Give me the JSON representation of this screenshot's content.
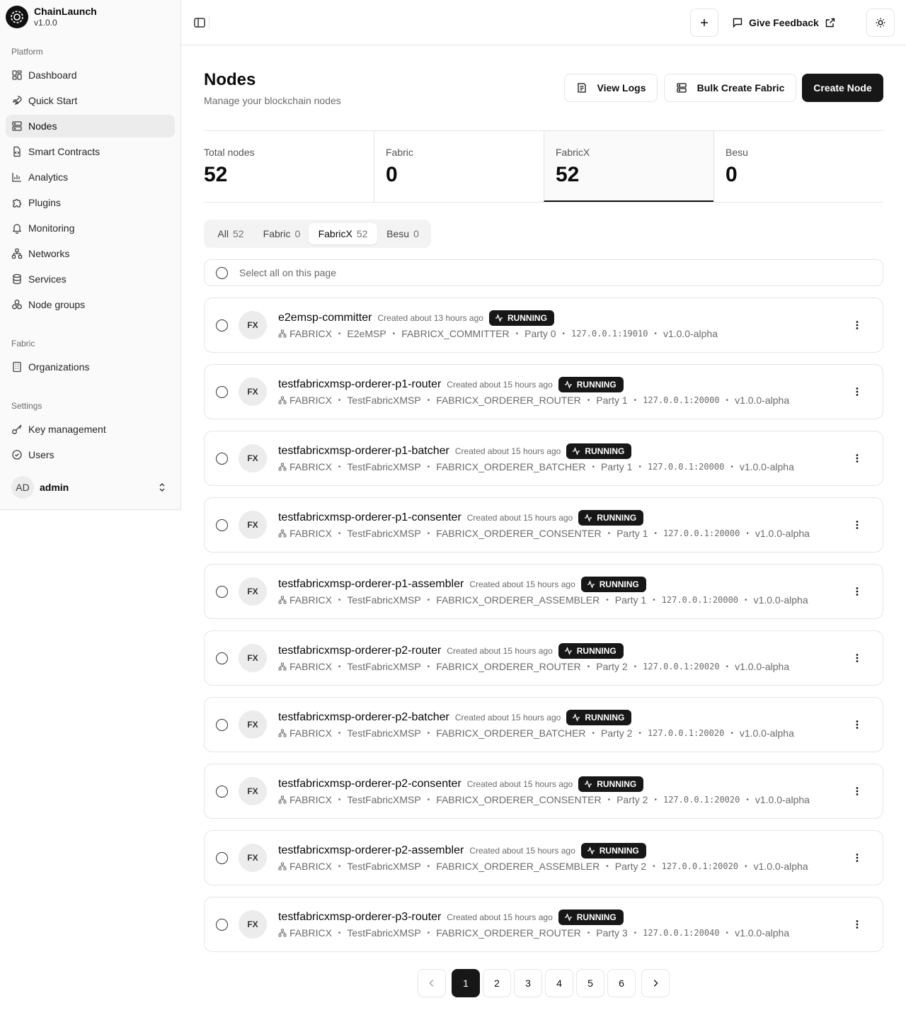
{
  "brand": {
    "name": "ChainLaunch",
    "version": "v1.0.0"
  },
  "sidebar": {
    "groups": [
      {
        "label": "Platform",
        "items": [
          {
            "label": "Dashboard",
            "icon": "dashboard-icon"
          },
          {
            "label": "Quick Start",
            "icon": "rocket-icon"
          },
          {
            "label": "Nodes",
            "icon": "server-icon",
            "active": true
          },
          {
            "label": "Smart Contracts",
            "icon": "file-code-icon"
          },
          {
            "label": "Analytics",
            "icon": "bar-chart-icon"
          },
          {
            "label": "Plugins",
            "icon": "puzzle-icon"
          },
          {
            "label": "Monitoring",
            "icon": "bell-icon"
          },
          {
            "label": "Networks",
            "icon": "network-icon"
          },
          {
            "label": "Services",
            "icon": "database-icon"
          },
          {
            "label": "Node groups",
            "icon": "boxes-icon"
          }
        ]
      },
      {
        "label": "Fabric",
        "items": [
          {
            "label": "Organizations",
            "icon": "building-icon"
          }
        ]
      },
      {
        "label": "Settings",
        "items": [
          {
            "label": "Key management",
            "icon": "key-icon"
          },
          {
            "label": "Users",
            "icon": "user-check-icon"
          }
        ]
      }
    ],
    "user": {
      "initials": "AD",
      "name": "admin"
    }
  },
  "header": {
    "feedback_label": "Give Feedback"
  },
  "page": {
    "title": "Nodes",
    "subtitle": "Manage your blockchain nodes",
    "view_logs_label": "View Logs",
    "bulk_create_label": "Bulk Create Fabric",
    "create_node_label": "Create Node"
  },
  "stats": [
    {
      "label": "Total nodes",
      "value": "52"
    },
    {
      "label": "Fabric",
      "value": "0"
    },
    {
      "label": "FabricX",
      "value": "52",
      "active": true
    },
    {
      "label": "Besu",
      "value": "0"
    }
  ],
  "tabs": [
    {
      "label": "All",
      "count": "52"
    },
    {
      "label": "Fabric",
      "count": "0"
    },
    {
      "label": "FabricX",
      "count": "52",
      "active": true
    },
    {
      "label": "Besu",
      "count": "0"
    }
  ],
  "select_all_label": "Select all on this page",
  "nodes": [
    {
      "avatar": "FX",
      "name": "e2emsp-committer",
      "created": "Created about 13 hours ago",
      "status": "RUNNING",
      "platform": "FABRICX",
      "msp": "E2eMSP",
      "role": "FABRICX_COMMITTER",
      "party": "Party 0",
      "address": "127.0.0.1:19010",
      "version": "v1.0.0-alpha"
    },
    {
      "avatar": "FX",
      "name": "testfabricxmsp-orderer-p1-router",
      "created": "Created about 15 hours ago",
      "status": "RUNNING",
      "platform": "FABRICX",
      "msp": "TestFabricXMSP",
      "role": "FABRICX_ORDERER_ROUTER",
      "party": "Party 1",
      "address": "127.0.0.1:20000",
      "version": "v1.0.0-alpha"
    },
    {
      "avatar": "FX",
      "name": "testfabricxmsp-orderer-p1-batcher",
      "created": "Created about 15 hours ago",
      "status": "RUNNING",
      "platform": "FABRICX",
      "msp": "TestFabricXMSP",
      "role": "FABRICX_ORDERER_BATCHER",
      "party": "Party 1",
      "address": "127.0.0.1:20000",
      "version": "v1.0.0-alpha"
    },
    {
      "avatar": "FX",
      "name": "testfabricxmsp-orderer-p1-consenter",
      "created": "Created about 15 hours ago",
      "status": "RUNNING",
      "platform": "FABRICX",
      "msp": "TestFabricXMSP",
      "role": "FABRICX_ORDERER_CONSENTER",
      "party": "Party 1",
      "address": "127.0.0.1:20000",
      "version": "v1.0.0-alpha"
    },
    {
      "avatar": "FX",
      "name": "testfabricxmsp-orderer-p1-assembler",
      "created": "Created about 15 hours ago",
      "status": "RUNNING",
      "platform": "FABRICX",
      "msp": "TestFabricXMSP",
      "role": "FABRICX_ORDERER_ASSEMBLER",
      "party": "Party 1",
      "address": "127.0.0.1:20000",
      "version": "v1.0.0-alpha"
    },
    {
      "avatar": "FX",
      "name": "testfabricxmsp-orderer-p2-router",
      "created": "Created about 15 hours ago",
      "status": "RUNNING",
      "platform": "FABRICX",
      "msp": "TestFabricXMSP",
      "role": "FABRICX_ORDERER_ROUTER",
      "party": "Party 2",
      "address": "127.0.0.1:20020",
      "version": "v1.0.0-alpha"
    },
    {
      "avatar": "FX",
      "name": "testfabricxmsp-orderer-p2-batcher",
      "created": "Created about 15 hours ago",
      "status": "RUNNING",
      "platform": "FABRICX",
      "msp": "TestFabricXMSP",
      "role": "FABRICX_ORDERER_BATCHER",
      "party": "Party 2",
      "address": "127.0.0.1:20020",
      "version": "v1.0.0-alpha"
    },
    {
      "avatar": "FX",
      "name": "testfabricxmsp-orderer-p2-consenter",
      "created": "Created about 15 hours ago",
      "status": "RUNNING",
      "platform": "FABRICX",
      "msp": "TestFabricXMSP",
      "role": "FABRICX_ORDERER_CONSENTER",
      "party": "Party 2",
      "address": "127.0.0.1:20020",
      "version": "v1.0.0-alpha"
    },
    {
      "avatar": "FX",
      "name": "testfabricxmsp-orderer-p2-assembler",
      "created": "Created about 15 hours ago",
      "status": "RUNNING",
      "platform": "FABRICX",
      "msp": "TestFabricXMSP",
      "role": "FABRICX_ORDERER_ASSEMBLER",
      "party": "Party 2",
      "address": "127.0.0.1:20020",
      "version": "v1.0.0-alpha"
    },
    {
      "avatar": "FX",
      "name": "testfabricxmsp-orderer-p3-router",
      "created": "Created about 15 hours ago",
      "status": "RUNNING",
      "platform": "FABRICX",
      "msp": "TestFabricXMSP",
      "role": "FABRICX_ORDERER_ROUTER",
      "party": "Party 3",
      "address": "127.0.0.1:20040",
      "version": "v1.0.0-alpha"
    }
  ],
  "pagination": {
    "pages": [
      "1",
      "2",
      "3",
      "4",
      "5",
      "6"
    ],
    "current": "1"
  },
  "colors": {
    "primary": "#171717",
    "border": "#e5e5e5",
    "muted": "#6b6b6b"
  }
}
